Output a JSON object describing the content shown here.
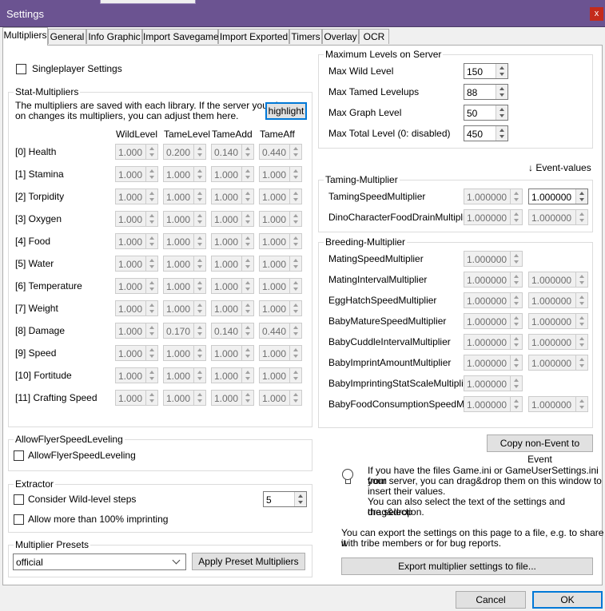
{
  "window": {
    "title": "Settings",
    "close_glyph": "x",
    "close_icon": "close-icon"
  },
  "tabs": [
    "Multipliers",
    "General",
    "Info Graphic",
    "Import Savegame",
    "Import Exported",
    "Timers",
    "Overlay",
    "OCR"
  ],
  "singleplayer": {
    "label": "Singleplayer Settings",
    "checked": false
  },
  "stat_multipliers": {
    "title": "Stat-Multipliers",
    "description_1": "The multipliers are saved with each library. If the server you play",
    "description_2": "on changes its multipliers, you can adjust them here.",
    "highlight_label": "highlight",
    "columns": [
      "WildLevel",
      "TameLevel",
      "TameAdd",
      "TameAff"
    ],
    "rows": [
      {
        "name": "[0] Health",
        "values": [
          "1.000",
          "0.200",
          "0.140",
          "0.440"
        ]
      },
      {
        "name": "[1] Stamina",
        "values": [
          "1.000",
          "1.000",
          "1.000",
          "1.000"
        ]
      },
      {
        "name": "[2] Torpidity",
        "values": [
          "1.000",
          "1.000",
          "1.000",
          "1.000"
        ]
      },
      {
        "name": "[3] Oxygen",
        "values": [
          "1.000",
          "1.000",
          "1.000",
          "1.000"
        ]
      },
      {
        "name": "[4] Food",
        "values": [
          "1.000",
          "1.000",
          "1.000",
          "1.000"
        ]
      },
      {
        "name": "[5] Water",
        "values": [
          "1.000",
          "1.000",
          "1.000",
          "1.000"
        ]
      },
      {
        "name": "[6] Temperature",
        "values": [
          "1.000",
          "1.000",
          "1.000",
          "1.000"
        ]
      },
      {
        "name": "[7] Weight",
        "values": [
          "1.000",
          "1.000",
          "1.000",
          "1.000"
        ]
      },
      {
        "name": "[8] Damage",
        "values": [
          "1.000",
          "0.170",
          "0.140",
          "0.440"
        ]
      },
      {
        "name": "[9] Speed",
        "values": [
          "1.000",
          "1.000",
          "1.000",
          "1.000"
        ]
      },
      {
        "name": "[10] Fortitude",
        "values": [
          "1.000",
          "1.000",
          "1.000",
          "1.000"
        ]
      },
      {
        "name": "[11] Crafting Speed",
        "values": [
          "1.000",
          "1.000",
          "1.000",
          "1.000"
        ]
      }
    ]
  },
  "flyer": {
    "title": "AllowFlyerSpeedLeveling",
    "checkbox_label": "AllowFlyerSpeedLeveling",
    "checked": false
  },
  "extractor": {
    "title": "Extractor",
    "wild_steps_label": "Consider Wild-level steps",
    "wild_steps_value": "5",
    "imprinting_label": "Allow more than 100% imprinting"
  },
  "presets": {
    "title": "Multiplier Presets",
    "selected": "official",
    "apply_label": "Apply Preset Multipliers"
  },
  "max_levels": {
    "title": "Maximum Levels on Server",
    "rows": [
      {
        "label": "Max Wild Level",
        "value": "150"
      },
      {
        "label": "Max Tamed Levelups",
        "value": "88"
      },
      {
        "label": "Max Graph Level",
        "value": "50"
      },
      {
        "label": "Max Total Level (0: disabled)",
        "value": "450"
      }
    ]
  },
  "event_values_label": "↓ Event-values",
  "taming": {
    "title": "Taming-Multiplier",
    "rows": [
      {
        "label": "TamingSpeedMultiplier",
        "value": "1.000000",
        "event": "1.000000"
      },
      {
        "label": "DinoCharacterFoodDrainMultiplier",
        "value": "1.000000",
        "event": "1.000000"
      }
    ]
  },
  "breeding": {
    "title": "Breeding-Multiplier",
    "rows": [
      {
        "label": "MatingSpeedMultiplier",
        "value": "1.000000",
        "event": null
      },
      {
        "label": "MatingIntervalMultiplier",
        "value": "1.000000",
        "event": "1.000000"
      },
      {
        "label": "EggHatchSpeedMultiplier",
        "value": "1.000000",
        "event": "1.000000"
      },
      {
        "label": "BabyMatureSpeedMultiplier",
        "value": "1.000000",
        "event": "1.000000"
      },
      {
        "label": "BabyCuddleIntervalMultiplier",
        "value": "1.000000",
        "event": "1.000000"
      },
      {
        "label": "BabyImprintAmountMultiplier",
        "value": "1.000000",
        "event": "1.000000"
      },
      {
        "label": "BabyImprintingStatScaleMultiplier",
        "value": "1.000000",
        "event": null
      },
      {
        "label": "BabyFoodConsumptionSpeedMult",
        "value": "1.000000",
        "event": "1.000000"
      }
    ]
  },
  "copy_event_label": "Copy non-Event to Event",
  "info": {
    "icon": "lightbulb-icon",
    "line1": "If you have the files Game.ini or GameUserSettings.ini from",
    "line2": "your server, you can drag&drop them on this window to",
    "line3": "insert their values.",
    "line4": "You can also select the text of the settings and drag&drop",
    "line5": "the selection."
  },
  "export": {
    "line1": "You can export the settings on this page to a file, e.g. to share it",
    "line2": "with tribe members or for bug reports.",
    "button_label": "Export multiplier settings to file..."
  },
  "dialog": {
    "cancel_label": "Cancel",
    "ok_label": "OK"
  }
}
